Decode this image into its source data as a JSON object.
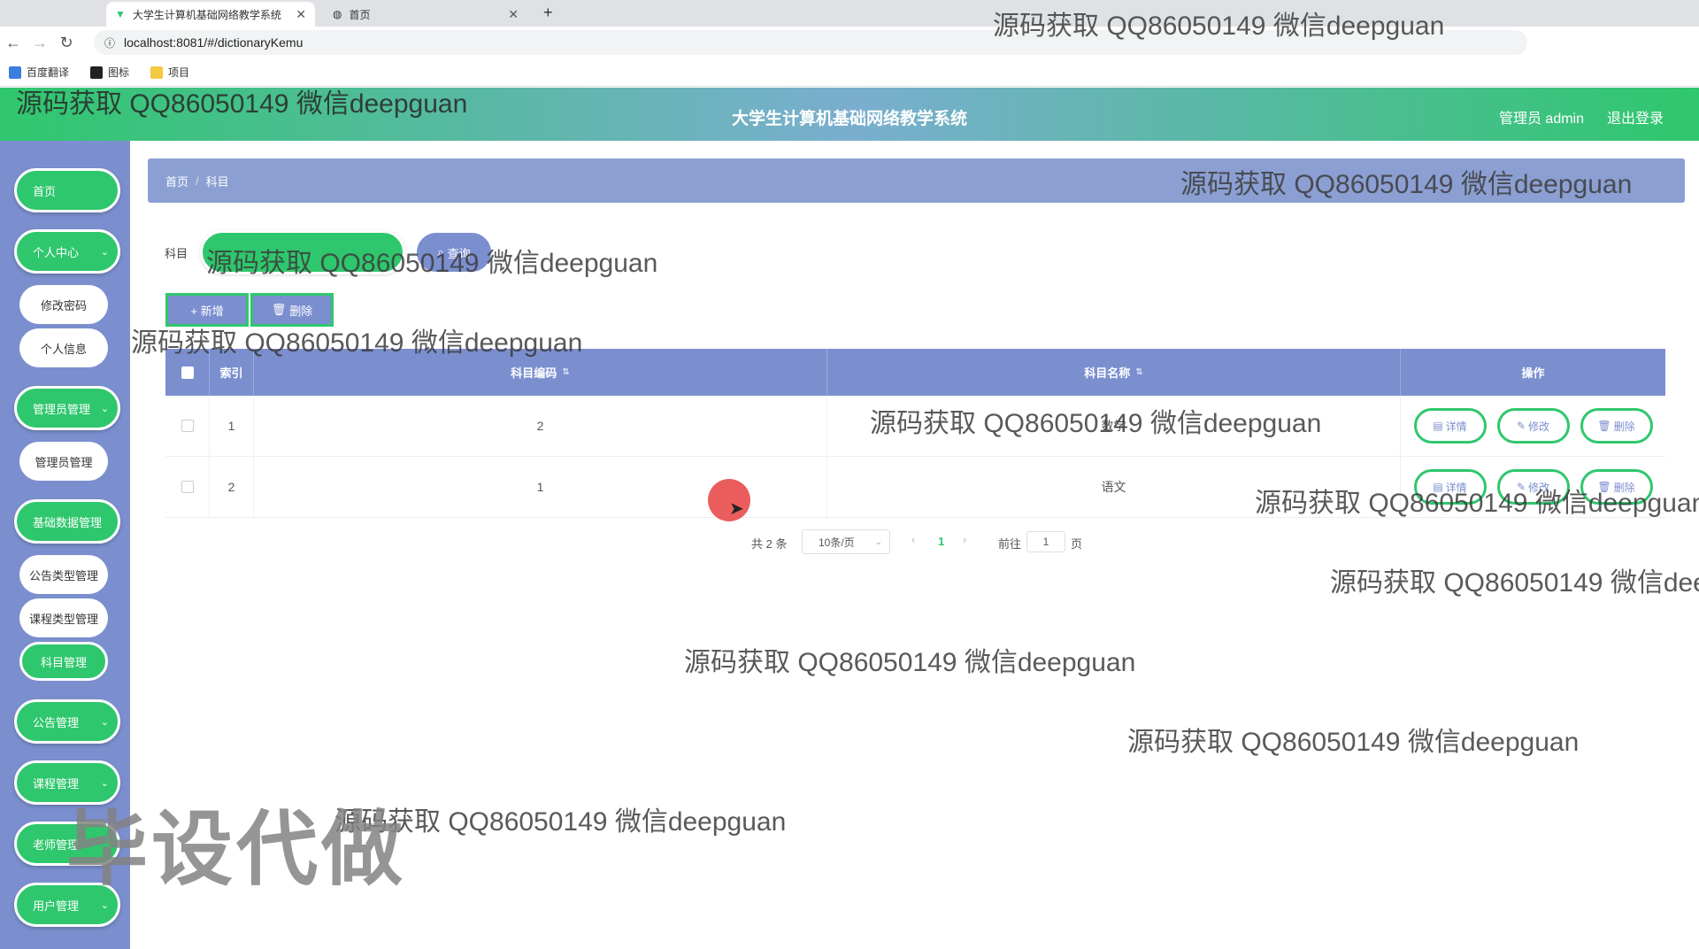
{
  "browser": {
    "tabs": [
      {
        "title": "大学生计算机基础网络教学系统"
      },
      {
        "title": "首页"
      }
    ],
    "url": "localhost:8081/#/dictionaryKemu",
    "bookmarks": [
      "百度翻译",
      "图标",
      "项目"
    ]
  },
  "header": {
    "title": "大学生计算机基础网络教学系统",
    "user": "管理员 admin",
    "logout": "退出登录"
  },
  "sidebar": {
    "items": [
      {
        "label": "首页"
      },
      {
        "label": "个人中心"
      },
      {
        "label": "修改密码"
      },
      {
        "label": "个人信息"
      },
      {
        "label": "管理员管理"
      },
      {
        "label": "管理员管理"
      },
      {
        "label": "基础数据管理"
      },
      {
        "label": "公告类型管理"
      },
      {
        "label": "课程类型管理"
      },
      {
        "label": "科目管理"
      },
      {
        "label": "公告管理"
      },
      {
        "label": "课程管理"
      },
      {
        "label": "老师管理"
      },
      {
        "label": "用户管理"
      }
    ]
  },
  "breadcrumb": {
    "home": "首页",
    "current": "科目"
  },
  "search": {
    "label": "科目",
    "button": "查询"
  },
  "actions": {
    "add": "+ 新增",
    "delete": "删除"
  },
  "table": {
    "columns": [
      "索引",
      "科目编码",
      "科目名称",
      "操作"
    ],
    "rows": [
      {
        "index": "1",
        "code": "2",
        "name": "数学"
      },
      {
        "index": "2",
        "code": "1",
        "name": "语文"
      }
    ],
    "row_actions": [
      "详情",
      "修改",
      "删除"
    ]
  },
  "pagination": {
    "total": "共 2 条",
    "page_size": "10条/页",
    "current": "1",
    "goto_label": "前往",
    "goto_value": "1",
    "page_suffix": "页"
  },
  "watermarks": {
    "text": "源码获取 QQ86050149 微信deepguan",
    "big": "毕设代做"
  },
  "colors": {
    "green": "#2fc76d",
    "blue": "#7b8fcf",
    "red_dot": "#e94b4b"
  }
}
